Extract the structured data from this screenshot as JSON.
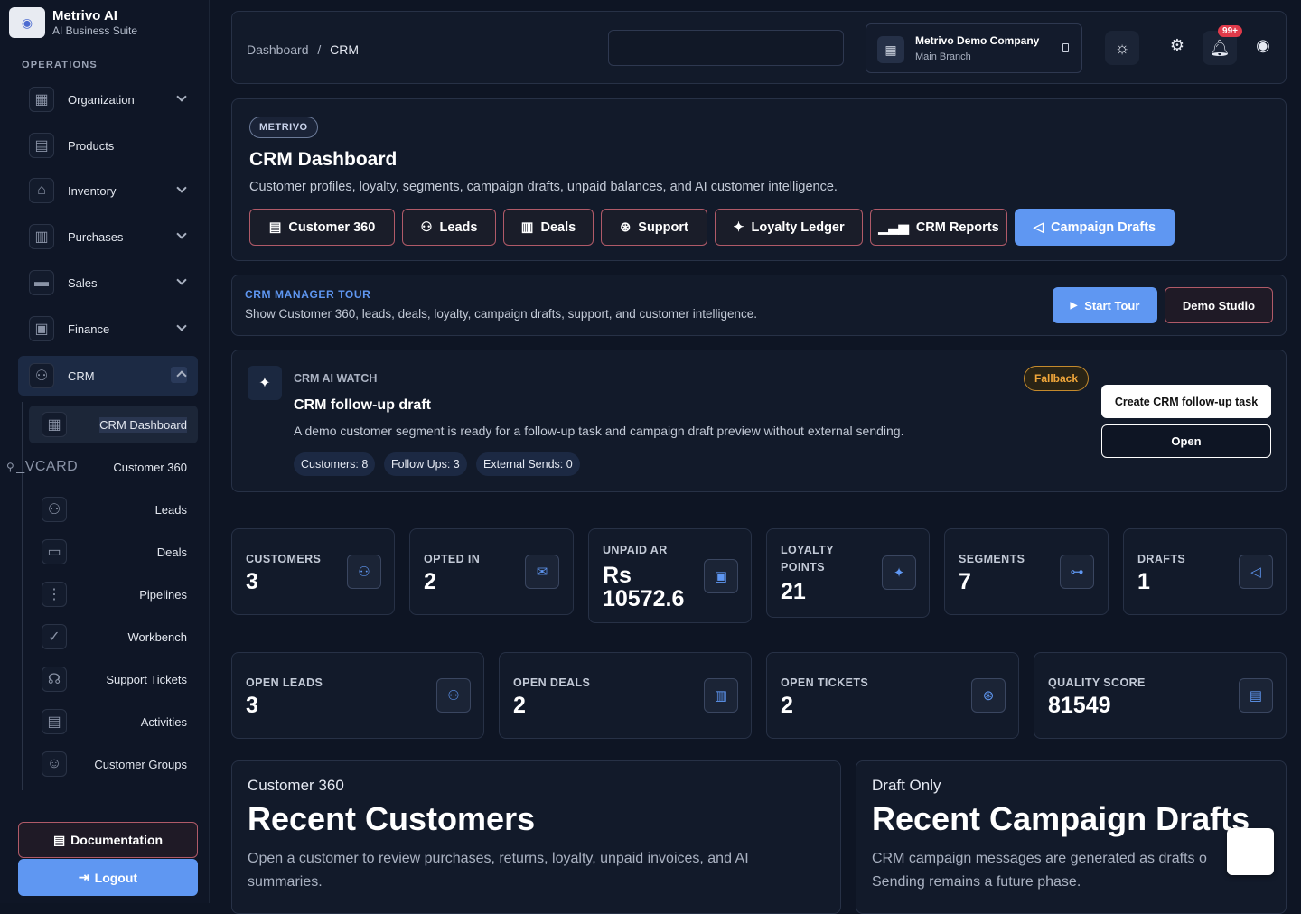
{
  "brand": {
    "name": "Metrivo AI",
    "sub": "AI Business Suite"
  },
  "sidebar": {
    "section_title": "OPERATIONS",
    "items": [
      {
        "label": "Organization"
      },
      {
        "label": "Products"
      },
      {
        "label": "Inventory"
      },
      {
        "label": "Purchases"
      },
      {
        "label": "Sales"
      },
      {
        "label": "Finance"
      },
      {
        "label": "CRM"
      }
    ],
    "crm_sub": [
      {
        "label": "CRM Dashboard"
      },
      {
        "label": "Customer 360"
      },
      {
        "label": "Leads"
      },
      {
        "label": "Deals"
      },
      {
        "label": "Pipelines"
      },
      {
        "label": "Workbench"
      },
      {
        "label": "Support Tickets"
      },
      {
        "label": "Activities"
      },
      {
        "label": "Customer Groups"
      }
    ],
    "vcard_text": "_VCARD",
    "documentation": "Documentation",
    "logout": "Logout"
  },
  "topbar": {
    "breadcrumb_root": "Dashboard",
    "breadcrumb_sep": "/",
    "breadcrumb_current": "CRM",
    "company_name": "Metrivo Demo Company",
    "company_branch": "Main Branch",
    "notification_badge": "99+"
  },
  "hero": {
    "pill": "METRIVO",
    "title": "CRM Dashboard",
    "description": "Customer profiles, loyalty, segments, campaign drafts, unpaid balances, and AI customer intelligence.",
    "tabs": [
      {
        "label": "Customer 360"
      },
      {
        "label": "Leads"
      },
      {
        "label": "Deals"
      },
      {
        "label": "Support"
      },
      {
        "label": "Loyalty Ledger"
      },
      {
        "label": "CRM Reports"
      },
      {
        "label": "Campaign Drafts"
      }
    ]
  },
  "tour": {
    "title": "CRM MANAGER TOUR",
    "description": "Show Customer 360, leads, deals, loyalty, campaign drafts, support, and customer intelligence.",
    "start": "Start Tour",
    "demo": "Demo Studio"
  },
  "ai_watch": {
    "label": "CRM AI WATCH",
    "title": "CRM follow-up draft",
    "description": "A demo customer segment is ready for a follow-up task and campaign draft preview without external sending.",
    "chips": [
      "Customers: 8",
      "Follow Ups: 3",
      "External Sends: 0"
    ],
    "badge": "Fallback",
    "create": "Create CRM follow-up task",
    "open": "Open"
  },
  "stats_row1": [
    {
      "label": "CUSTOMERS",
      "value": "3",
      "icon": "users-icon"
    },
    {
      "label": "OPTED IN",
      "value": "2",
      "icon": "mail-check-icon"
    },
    {
      "label": "UNPAID AR",
      "value": "Rs 10572.6",
      "value_line1": "Rs",
      "value_line2": "10572.6",
      "icon": "cash-icon"
    },
    {
      "label": "LOYALTY POINTS",
      "label_line1": "LOYALTY",
      "label_line2": "POINTS",
      "value": "21",
      "icon": "sparkles-icon"
    },
    {
      "label": "SEGMENTS",
      "value": "7",
      "icon": "hierarchy-icon"
    },
    {
      "label": "DRAFTS",
      "value": "1",
      "icon": "megaphone-icon"
    }
  ],
  "stats_row2": [
    {
      "label": "OPEN LEADS",
      "value": "3",
      "icon": "user-plus-icon"
    },
    {
      "label": "OPEN DEALS",
      "value": "2",
      "icon": "kanban-icon"
    },
    {
      "label": "OPEN TICKETS",
      "value": "2",
      "icon": "lifebuoy-icon"
    },
    {
      "label": "QUALITY SCORE",
      "value": "81549",
      "icon": "clipboard-check-icon"
    }
  ],
  "panels": {
    "customers": {
      "kicker": "Customer 360",
      "title": "Recent Customers",
      "description": "Open a customer to review purchases, returns, loyalty, unpaid invoices, and AI summaries."
    },
    "drafts": {
      "kicker": "Draft Only",
      "title": "Recent Campaign Drafts",
      "description": "CRM campaign messages are generated as drafts o Sending remains a future phase."
    }
  },
  "colors": {
    "accent": "#5f97f2",
    "background": "#0e1524",
    "card": "#121a2a",
    "danger": "#e03a4a",
    "warning": "#f0a63a"
  }
}
